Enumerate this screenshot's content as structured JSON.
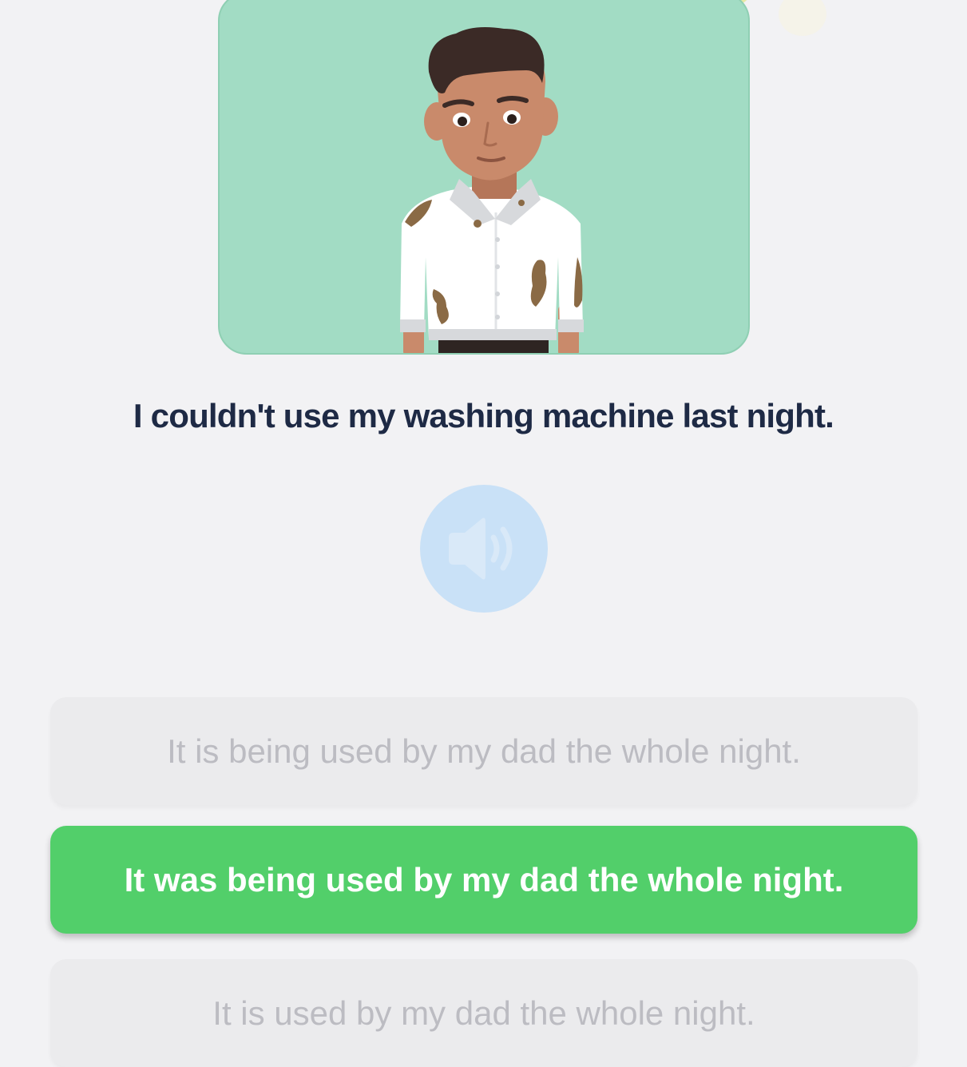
{
  "exercise": {
    "prompt": "I couldn't use my washing machine last night.",
    "audio_icon": "speaker-icon",
    "options": [
      {
        "label": "It is being used by my dad the whole night.",
        "state": "disabled"
      },
      {
        "label": "It was being used by my dad the whole night.",
        "state": "selected"
      },
      {
        "label": "It is used by my dad the whole night.",
        "state": "disabled"
      }
    ]
  },
  "colors": {
    "background": "#f2f2f4",
    "card": "#a2dcc4",
    "selected": "#52cf6a",
    "disabled_text": "#bcbcc2",
    "prompt_text": "#1e2a45",
    "audio_button": "#c9e1f7"
  }
}
